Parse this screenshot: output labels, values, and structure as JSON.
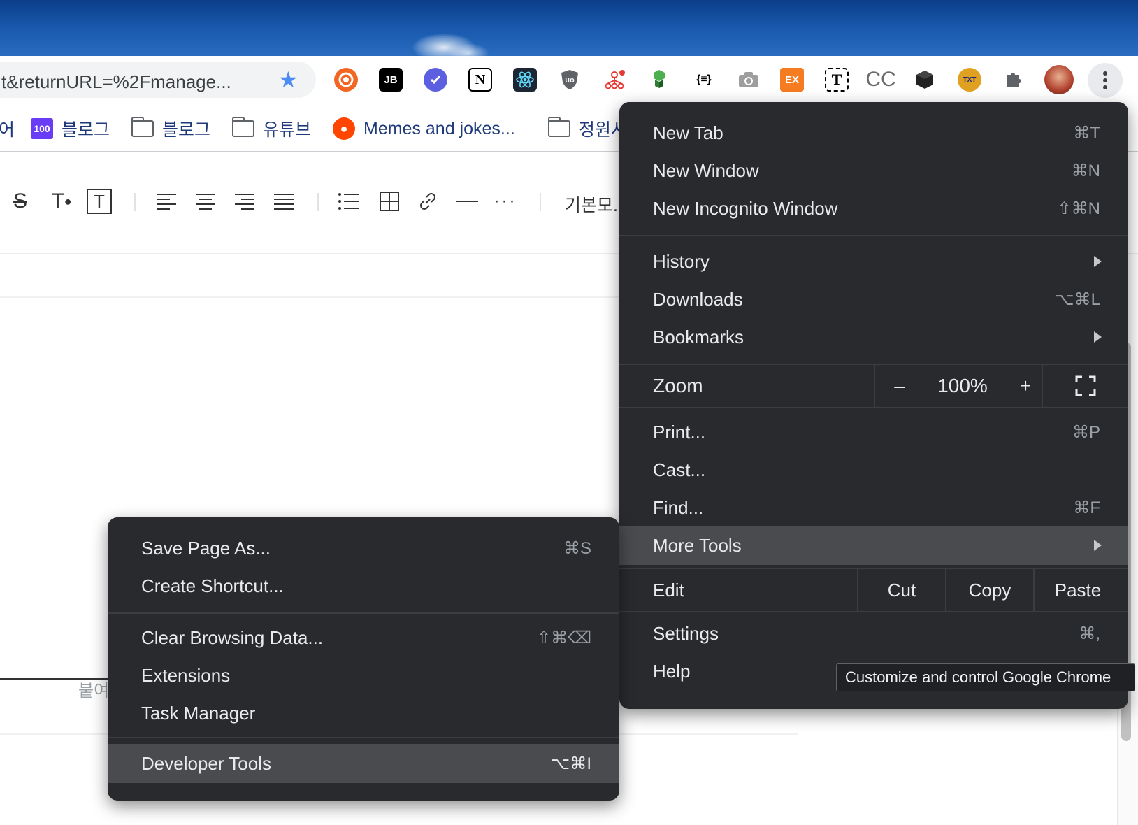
{
  "omnibox": {
    "url": "t&returnURL=%2Fmanage..."
  },
  "extensions": [
    {
      "icon": "lifebuoy-icon",
      "color": "#f26522"
    },
    {
      "icon": "jetbrains-icon",
      "text": "JB",
      "color": "#000000"
    },
    {
      "icon": "checkmark-badge-icon",
      "color": "#5b5fe0"
    },
    {
      "icon": "notion-icon",
      "text": "N",
      "color": "#000000"
    },
    {
      "icon": "react-devtools-icon",
      "color": "#1c2533"
    },
    {
      "icon": "ublock-shield-icon",
      "text": "uo",
      "color": "#5f6368"
    },
    {
      "icon": "network-graph-icon",
      "color": "#e53935"
    },
    {
      "icon": "green-cubes-icon",
      "color": "#2e7d32"
    },
    {
      "icon": "json-formatter-icon",
      "text": "{≡}",
      "color": "#000000"
    },
    {
      "icon": "camera-icon",
      "color": "#8a8a8a"
    },
    {
      "icon": "ex-icon",
      "text": "EX",
      "color": "#f57c20"
    },
    {
      "icon": "text-t-icon",
      "text": "T",
      "color": "#000000"
    },
    {
      "icon": "cc-icon",
      "text": "CC",
      "color": "#6b6b6b"
    },
    {
      "icon": "black-cube-icon",
      "color": "#222222"
    },
    {
      "icon": "txt-icon",
      "text": "TXT",
      "color": "#e0a020"
    },
    {
      "icon": "puzzle-icon",
      "color": "#5f6368"
    },
    {
      "icon": "avatar-icon",
      "color": "#b0412e"
    }
  ],
  "bookmarks": [
    {
      "label": "어",
      "type": "text"
    },
    {
      "label": "블로그",
      "type": "badge",
      "badge": "100"
    },
    {
      "label": "블로그",
      "type": "folder"
    },
    {
      "label": "유튜브",
      "type": "folder"
    },
    {
      "label": "Memes and jokes...",
      "type": "reddit"
    },
    {
      "label": "정원시",
      "type": "folder"
    }
  ],
  "editor": {
    "font_label": "기본모..."
  },
  "content": {
    "fragment": "붙여"
  },
  "main_menu": {
    "new_tab": {
      "label": "New Tab",
      "shortcut": "⌘T"
    },
    "new_window": {
      "label": "New Window",
      "shortcut": "⌘N"
    },
    "new_incognito": {
      "label": "New Incognito Window",
      "shortcut": "⇧⌘N"
    },
    "history": {
      "label": "History"
    },
    "downloads": {
      "label": "Downloads",
      "shortcut": "⌥⌘L"
    },
    "bookmarks": {
      "label": "Bookmarks"
    },
    "zoom": {
      "label": "Zoom",
      "minus": "–",
      "value": "100%",
      "plus": "+"
    },
    "print": {
      "label": "Print...",
      "shortcut": "⌘P"
    },
    "cast": {
      "label": "Cast..."
    },
    "find": {
      "label": "Find...",
      "shortcut": "⌘F"
    },
    "more_tools": {
      "label": "More Tools"
    },
    "edit": {
      "label": "Edit",
      "cut": "Cut",
      "copy": "Copy",
      "paste": "Paste"
    },
    "settings": {
      "label": "Settings",
      "shortcut": "⌘,"
    },
    "help": {
      "label": "Help"
    }
  },
  "sub_menu": {
    "save_page": {
      "label": "Save Page As...",
      "shortcut": "⌘S"
    },
    "create_shortcut": {
      "label": "Create Shortcut..."
    },
    "clear_browsing": {
      "label": "Clear Browsing Data...",
      "shortcut": "⇧⌘⌫"
    },
    "extensions": {
      "label": "Extensions"
    },
    "task_manager": {
      "label": "Task Manager"
    },
    "developer_tools": {
      "label": "Developer Tools",
      "shortcut": "⌥⌘I"
    }
  },
  "tooltip": "Customize and control Google Chrome"
}
